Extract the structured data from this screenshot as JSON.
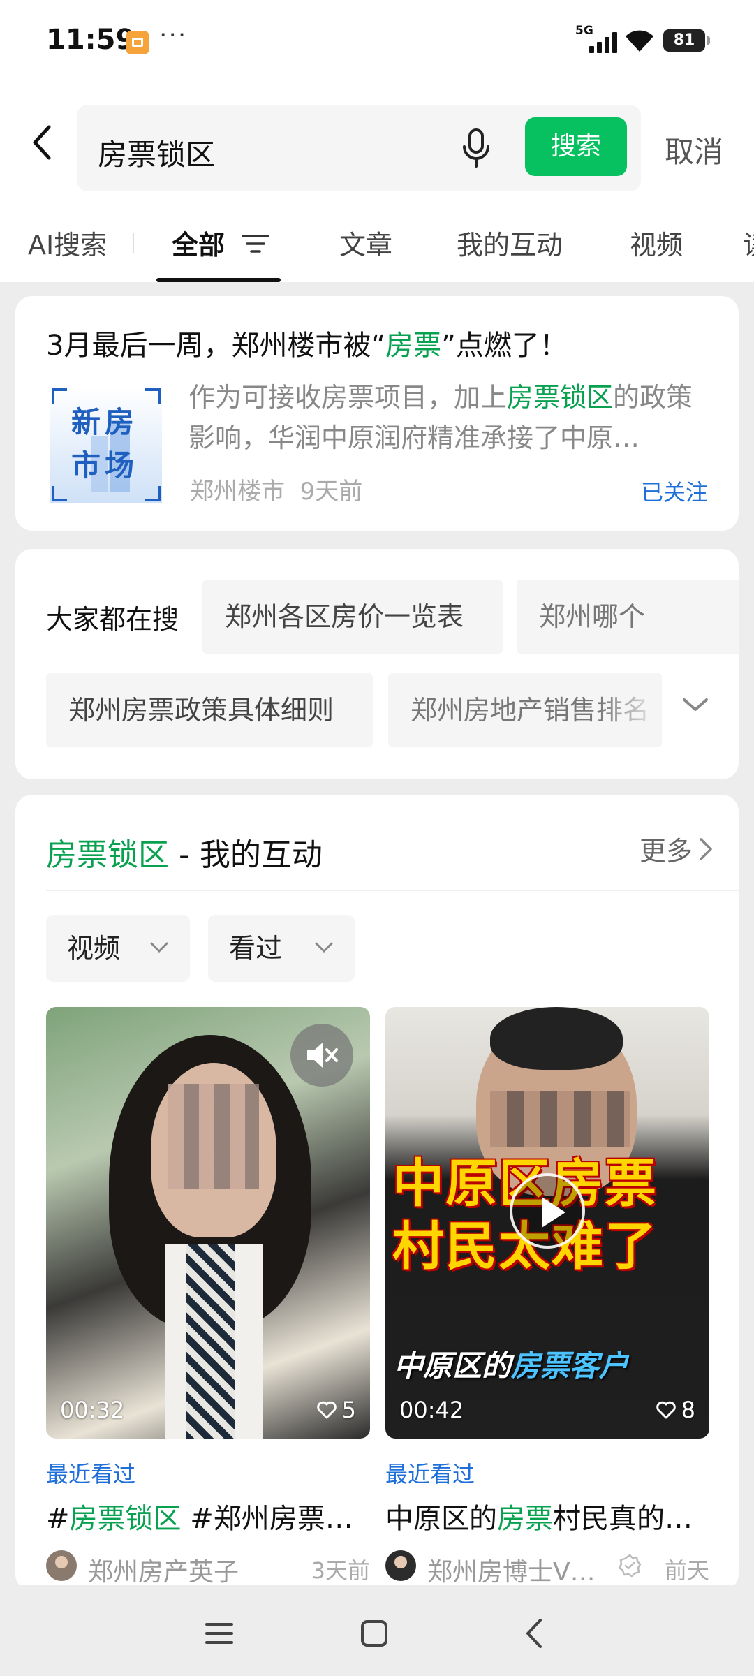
{
  "status_bar": {
    "time": "11:59",
    "more": "···",
    "network": "5G",
    "battery": "81"
  },
  "search": {
    "query": "房票锁区",
    "search_label": "搜索",
    "cancel_label": "取消"
  },
  "tabs": [
    {
      "label": "AI搜索"
    },
    {
      "label": "全部",
      "active": true
    },
    {
      "label": "文章"
    },
    {
      "label": "我的互动"
    },
    {
      "label": "视频"
    },
    {
      "label": "读"
    }
  ],
  "article": {
    "title_pre": "3月最后一周，郑州楼市被“",
    "title_hl": "房票",
    "title_post": "”点燃了！",
    "thumb_text": "新房市场",
    "summary_pre": "作为可接收房票项目，加上",
    "summary_hl": "房票锁区",
    "summary_post": "的政策影响，华润中原润府精准承接了中原…",
    "source": "郑州楼市",
    "time": "9天前",
    "followed": "已关注"
  },
  "hot_searches": {
    "label": "大家都在搜",
    "items": [
      "郑州各区房价一览表",
      "郑州哪个",
      "郑州房票政策具体细则",
      "郑州房地产销售排名"
    ]
  },
  "interactions": {
    "title_hl": "房票锁区",
    "title_rest": " - 我的互动",
    "more": "更多",
    "filters": [
      "视频",
      "看过"
    ],
    "videos": [
      {
        "duration": "00:32",
        "likes": "5",
        "recent": "最近看过",
        "caption_pre": "#",
        "caption_hl": "房票锁区",
        "caption_post": " #郑州房票…",
        "author": "郑州房产英子",
        "time": "3天前"
      },
      {
        "duration": "00:42",
        "likes": "8",
        "overlay_line1": "中原区房票",
        "overlay_line2": "村民太难了",
        "overlay_sub_pre": "中原区的",
        "overlay_sub_hl": "房票客户",
        "recent": "最近看过",
        "caption_pre": "中原区的",
        "caption_hl": "房票",
        "caption_post": "村民真的…",
        "author": "郑州房博士V…",
        "time": "前天"
      }
    ]
  },
  "colors": {
    "accent_green": "#07c160",
    "highlight_green": "#07a150",
    "link_blue": "#1e6fd9"
  }
}
